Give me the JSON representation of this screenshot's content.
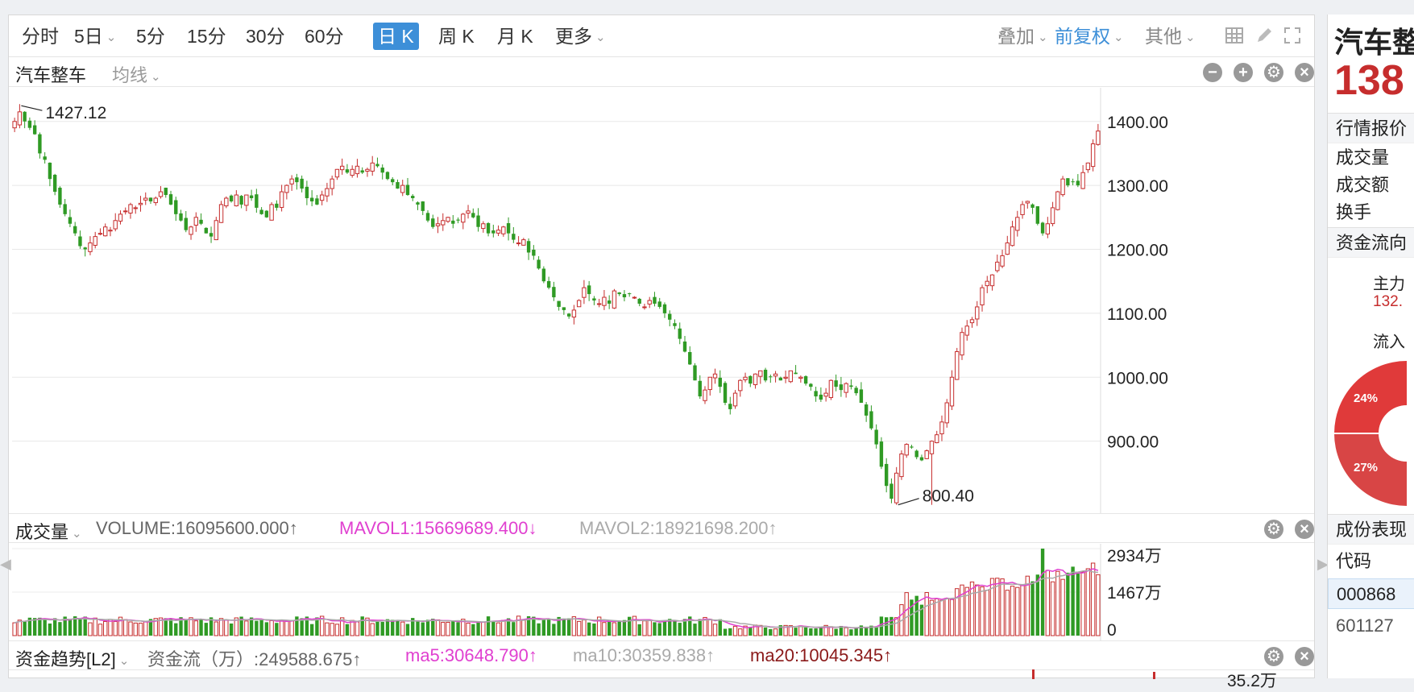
{
  "toolbar": {
    "periods": [
      "分时",
      "5日",
      "5分",
      "15分",
      "30分",
      "60分",
      "日 K",
      "周 K",
      "月 K",
      "更多"
    ],
    "active": "日 K",
    "overlay": "叠加",
    "adjust": "前复权",
    "other": "其他"
  },
  "price_panel": {
    "title": "汽车整车",
    "ma_select": "均线",
    "high_label": "1427.12",
    "low_label": "800.40",
    "y_ticks": [
      "1400.00",
      "1300.00",
      "1200.00",
      "1100.00",
      "1000.00",
      "900.00"
    ]
  },
  "volume_panel": {
    "title": "成交量",
    "volume": "VOLUME:16095600.000↑",
    "mavol1": "MAVOL1:15669689.400↓",
    "mavol2": "MAVOL2:18921698.200↑",
    "y_ticks": [
      "2934万",
      "1467万",
      "0"
    ]
  },
  "fund_panel": {
    "title": "资金趋势[L2]",
    "flow": "资金流（万）:249588.675↑",
    "ma5": "ma5:30648.790↑",
    "ma10": "ma10:30359.838↑",
    "ma20": "ma20:10045.345↑",
    "y_tick": "35.2万"
  },
  "sidebar": {
    "name": "汽车整",
    "price": "138",
    "quote": "行情报价",
    "volume": "成交量",
    "amount": "成交额",
    "turnover": "换手",
    "flow": "资金流向",
    "main_force": "主力",
    "main_value": "132.",
    "inflow": "流入",
    "pie_a": "24%",
    "pie_b": "27%",
    "components": "成份表现",
    "code_header": "代码",
    "codes": [
      "000868",
      "601127"
    ]
  },
  "colors": {
    "up": "#c62d2d",
    "down": "#2f9a24",
    "accent": "#3d8fd8",
    "mavol1": "#e040d0",
    "mavol2": "#aaaaaa",
    "ma20": "#8b1a1a"
  },
  "chart_data": {
    "type": "candlestick",
    "title": "汽车整车",
    "ylim": [
      800,
      1440
    ],
    "high": 1427.12,
    "low": 800.4,
    "closes": [
      1400,
      1415,
      1400,
      1390,
      1380,
      1350,
      1340,
      1310,
      1290,
      1270,
      1255,
      1240,
      1225,
      1205,
      1200,
      1210,
      1220,
      1225,
      1235,
      1230,
      1245,
      1255,
      1260,
      1270,
      1265,
      1272,
      1280,
      1275,
      1280,
      1290,
      1285,
      1270,
      1255,
      1245,
      1230,
      1235,
      1250,
      1240,
      1225,
      1220,
      1245,
      1270,
      1280,
      1275,
      1285,
      1270,
      1285,
      1280,
      1265,
      1255,
      1250,
      1270,
      1265,
      1290,
      1300,
      1310,
      1305,
      1295,
      1280,
      1275,
      1270,
      1285,
      1295,
      1310,
      1325,
      1330,
      1320,
      1325,
      1330,
      1320,
      1325,
      1335,
      1330,
      1320,
      1310,
      1305,
      1295,
      1300,
      1285,
      1280,
      1270,
      1260,
      1245,
      1235,
      1240,
      1245,
      1250,
      1240,
      1245,
      1255,
      1260,
      1250,
      1235,
      1240,
      1225,
      1225,
      1230,
      1235,
      1225,
      1215,
      1210,
      1215,
      1195,
      1190,
      1170,
      1150,
      1140,
      1125,
      1110,
      1105,
      1095,
      1105,
      1120,
      1140,
      1130,
      1120,
      1115,
      1125,
      1115,
      1135,
      1130,
      1125,
      1130,
      1125,
      1115,
      1110,
      1120,
      1115,
      1110,
      1100,
      1090,
      1080,
      1060,
      1040,
      1020,
      995,
      970,
      980,
      1000,
      1005,
      985,
      960,
      950,
      975,
      995,
      1000,
      990,
      1005,
      1010,
      995,
      1000,
      1005,
      995,
      1000,
      1010,
      1005,
      1000,
      990,
      985,
      970,
      965,
      975,
      995,
      985,
      980,
      990,
      985,
      975,
      960,
      940,
      920,
      895,
      860,
      830,
      810,
      850,
      880,
      895,
      890,
      875,
      870,
      885,
      900,
      910,
      930,
      960,
      1000,
      1040,
      1070,
      1080,
      1090,
      1110,
      1140,
      1150,
      1160,
      1180,
      1190,
      1210,
      1235,
      1250,
      1270,
      1275,
      1265,
      1240,
      1225,
      1240,
      1265,
      1290,
      1310,
      1300,
      1305,
      1300,
      1320,
      1335,
      1365,
      1385
    ],
    "volume_ylim": [
      0,
      2934
    ],
    "volume_scale_labels": [
      "2934万",
      "1467万",
      "0"
    ],
    "mavol1": 15669689.4,
    "mavol2": 18921698.2,
    "volume": 16095600.0
  }
}
